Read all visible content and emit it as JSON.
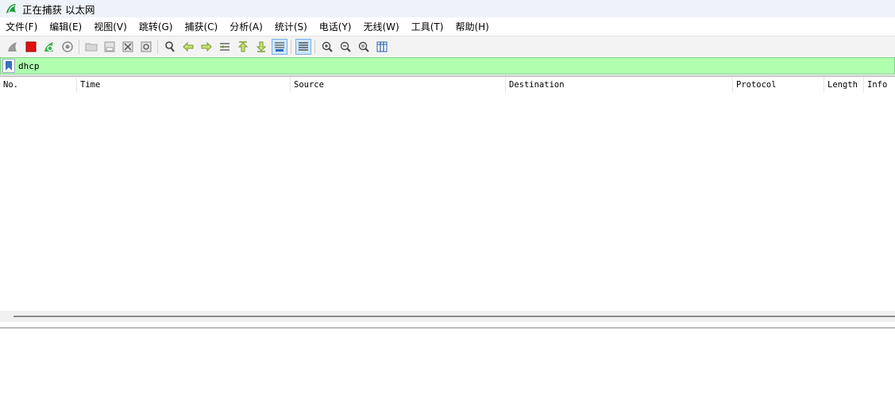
{
  "window": {
    "title": "正在捕获 以太网",
    "icon": "wireshark-fin-icon",
    "accent_color": "#1f9e3a"
  },
  "menu": [
    {
      "label": "文件(F)"
    },
    {
      "label": "编辑(E)"
    },
    {
      "label": "视图(V)"
    },
    {
      "label": "跳转(G)"
    },
    {
      "label": "捕获(C)"
    },
    {
      "label": "分析(A)"
    },
    {
      "label": "统计(S)"
    },
    {
      "label": "电话(Y)"
    },
    {
      "label": "无线(W)"
    },
    {
      "label": "工具(T)"
    },
    {
      "label": "帮助(H)"
    }
  ],
  "toolbar": {
    "icons": [
      "start-capture-icon",
      "stop-capture-icon",
      "restart-capture-icon",
      "capture-options-icon",
      "open-file-icon",
      "save-file-icon",
      "close-file-icon",
      "reload-file-icon",
      "find-packet-icon",
      "go-back-icon",
      "go-forward-icon",
      "go-to-packet-icon",
      "first-packet-icon",
      "last-packet-icon",
      "autoscroll-icon",
      "colorize-icon",
      "zoom-in-icon",
      "zoom-out-icon",
      "normal-size-icon",
      "resize-columns-icon"
    ]
  },
  "filter": {
    "value": "dhcp",
    "background_color": "#afffaf"
  },
  "packet_list": {
    "columns": [
      "No.",
      "Time",
      "Source",
      "Destination",
      "Protocol",
      "Length",
      "Info"
    ],
    "rows": []
  }
}
